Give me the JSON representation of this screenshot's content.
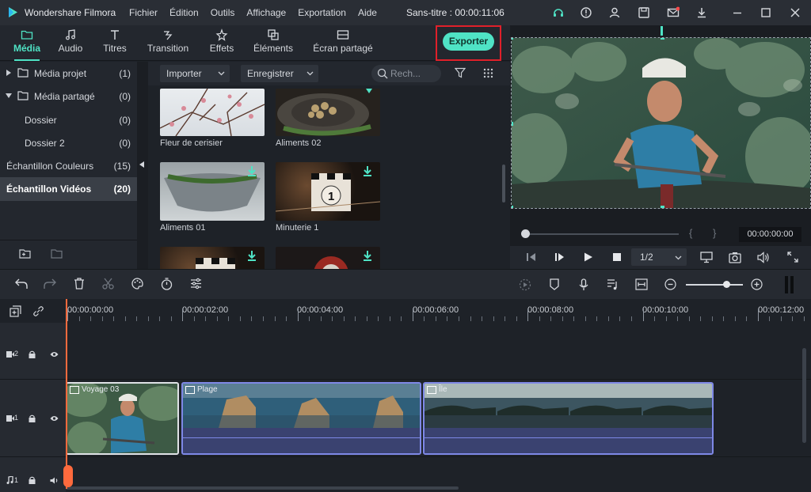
{
  "app": {
    "name": "Wondershare Filmora",
    "menu": [
      "Fichier",
      "Édition",
      "Outils",
      "Affichage",
      "Exportation",
      "Aide"
    ],
    "document_title": "Sans-titre : 00:00:11:06"
  },
  "tabs": [
    {
      "label": "Média",
      "icon": "folder-icon",
      "active": true
    },
    {
      "label": "Audio",
      "icon": "music-note-icon"
    },
    {
      "label": "Titres",
      "icon": "text-icon"
    },
    {
      "label": "Transition",
      "icon": "transition-icon"
    },
    {
      "label": "Effets",
      "icon": "effects-icon"
    },
    {
      "label": "Éléments",
      "icon": "elements-icon"
    },
    {
      "label": "Écran partagé",
      "icon": "split-screen-icon"
    }
  ],
  "export_label": "Exporter",
  "library": [
    {
      "label": "Média projet",
      "count": "(1)"
    },
    {
      "label": "Média partagé",
      "count": "(0)"
    },
    {
      "label": "Dossier",
      "count": "(0)"
    },
    {
      "label": "Dossier 2",
      "count": "(0)"
    },
    {
      "label": "Échantillon Couleurs",
      "count": "(15)"
    },
    {
      "label": "Échantillon Vidéos",
      "count": "(20)"
    }
  ],
  "media_toolbar": {
    "import_label": "Importer",
    "record_label": "Enregistrer",
    "search_placeholder": "Rech..."
  },
  "media_items": [
    "Fleur de cerisier",
    "Aliments 02",
    "Aliments 01",
    "Minuterie 1"
  ],
  "preview": {
    "time": "00:00:00:00",
    "ratio": "1/2",
    "progress": 0.0
  },
  "timeline": {
    "ruler_labels": [
      "00:00:00:00",
      "00:00:02:00",
      "00:00:04:00",
      "00:00:06:00",
      "00:00:08:00",
      "00:00:10:00",
      "00:00:12:00"
    ],
    "tracks": [
      {
        "label": "2",
        "type": "video"
      },
      {
        "label": "1",
        "type": "video"
      },
      {
        "label": "1",
        "type": "audio"
      }
    ],
    "clips": [
      "Voyage 03",
      "Plage",
      "Île"
    ]
  },
  "colors": {
    "accent": "#4fe3c5",
    "highlight": "#e0202a",
    "clip_border": "#7e88e6",
    "playhead": "#ff6a3d"
  }
}
